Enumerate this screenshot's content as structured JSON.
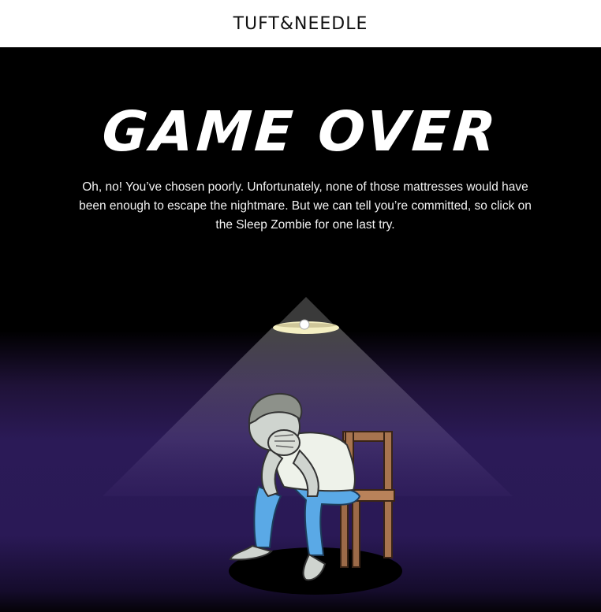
{
  "header": {
    "logo_text": "TUFT&NEEDLE"
  },
  "main": {
    "title": "GAME OVER",
    "message": "Oh, no! You’ve chosen poorly. Unfortunately, none of those mattresses would have been enough to escape the nightmare. But we can tell you’re committed, so click on the Sleep Zombie for one last try."
  },
  "colors": {
    "header_bg": "#ffffff",
    "page_bg": "#000000",
    "glow_purple": "#2b1a57",
    "lamp_light": "#f4efc2",
    "pants_blue": "#5aa9e6",
    "chair_brown": "#9c6a48"
  },
  "icons": {
    "lamp": "hanging-lamp-icon",
    "zombie": "sleep-zombie-illustration"
  }
}
